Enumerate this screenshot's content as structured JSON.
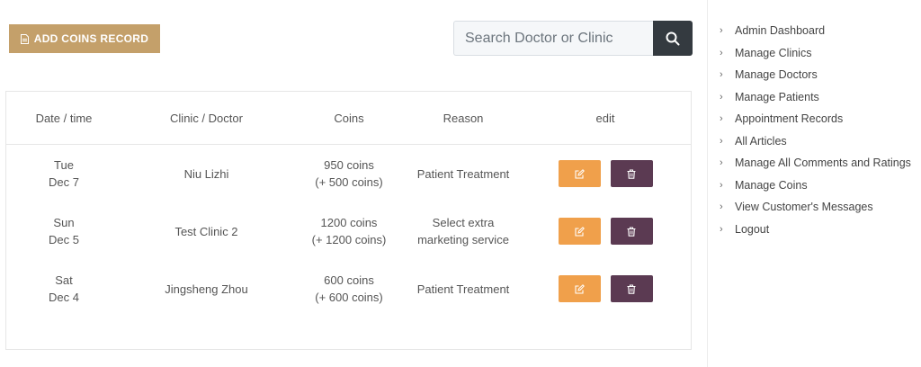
{
  "toolbar": {
    "add_label": "ADD COINS RECORD"
  },
  "search": {
    "placeholder": "Search Doctor or Clinic"
  },
  "table": {
    "headers": [
      "Date / time",
      "Clinic / Doctor",
      "Coins",
      "Reason",
      "edit"
    ],
    "rows": [
      {
        "day": "Tue",
        "date": "Dec 7",
        "party": "Niu Lizhi",
        "coins": "950 coins",
        "coins_delta": "(+ 500 coins)",
        "reason_1": "Patient Treatment",
        "reason_2": ""
      },
      {
        "day": "Sun",
        "date": "Dec 5",
        "party": "Test Clinic 2",
        "coins": "1200 coins",
        "coins_delta": "(+ 1200 coins)",
        "reason_1": "Select extra",
        "reason_2": "marketing service"
      },
      {
        "day": "Sat",
        "date": "Dec 4",
        "party": "Jingsheng Zhou",
        "coins": "600 coins",
        "coins_delta": "(+ 600 coins)",
        "reason_1": "Patient Treatment",
        "reason_2": ""
      }
    ]
  },
  "sidebar": {
    "items": [
      {
        "label": "Admin Dashboard"
      },
      {
        "label": "Manage Clinics"
      },
      {
        "label": "Manage Doctors"
      },
      {
        "label": "Manage Patients"
      },
      {
        "label": "Appointment Records"
      },
      {
        "label": "All Articles"
      },
      {
        "label": "Manage All Comments and Ratings"
      },
      {
        "label": "Manage Coins"
      },
      {
        "label": "View Customer's Messages"
      },
      {
        "label": "Logout"
      }
    ]
  },
  "colors": {
    "add_button": "#c4a06a",
    "edit_button": "#f0a04b",
    "delete_button": "#5b3a52",
    "search_button": "#343a40"
  },
  "icons": {
    "add": "file-icon",
    "search": "search-icon",
    "edit": "edit-icon",
    "delete": "trash-icon",
    "nav": "chevron-right-icon"
  }
}
